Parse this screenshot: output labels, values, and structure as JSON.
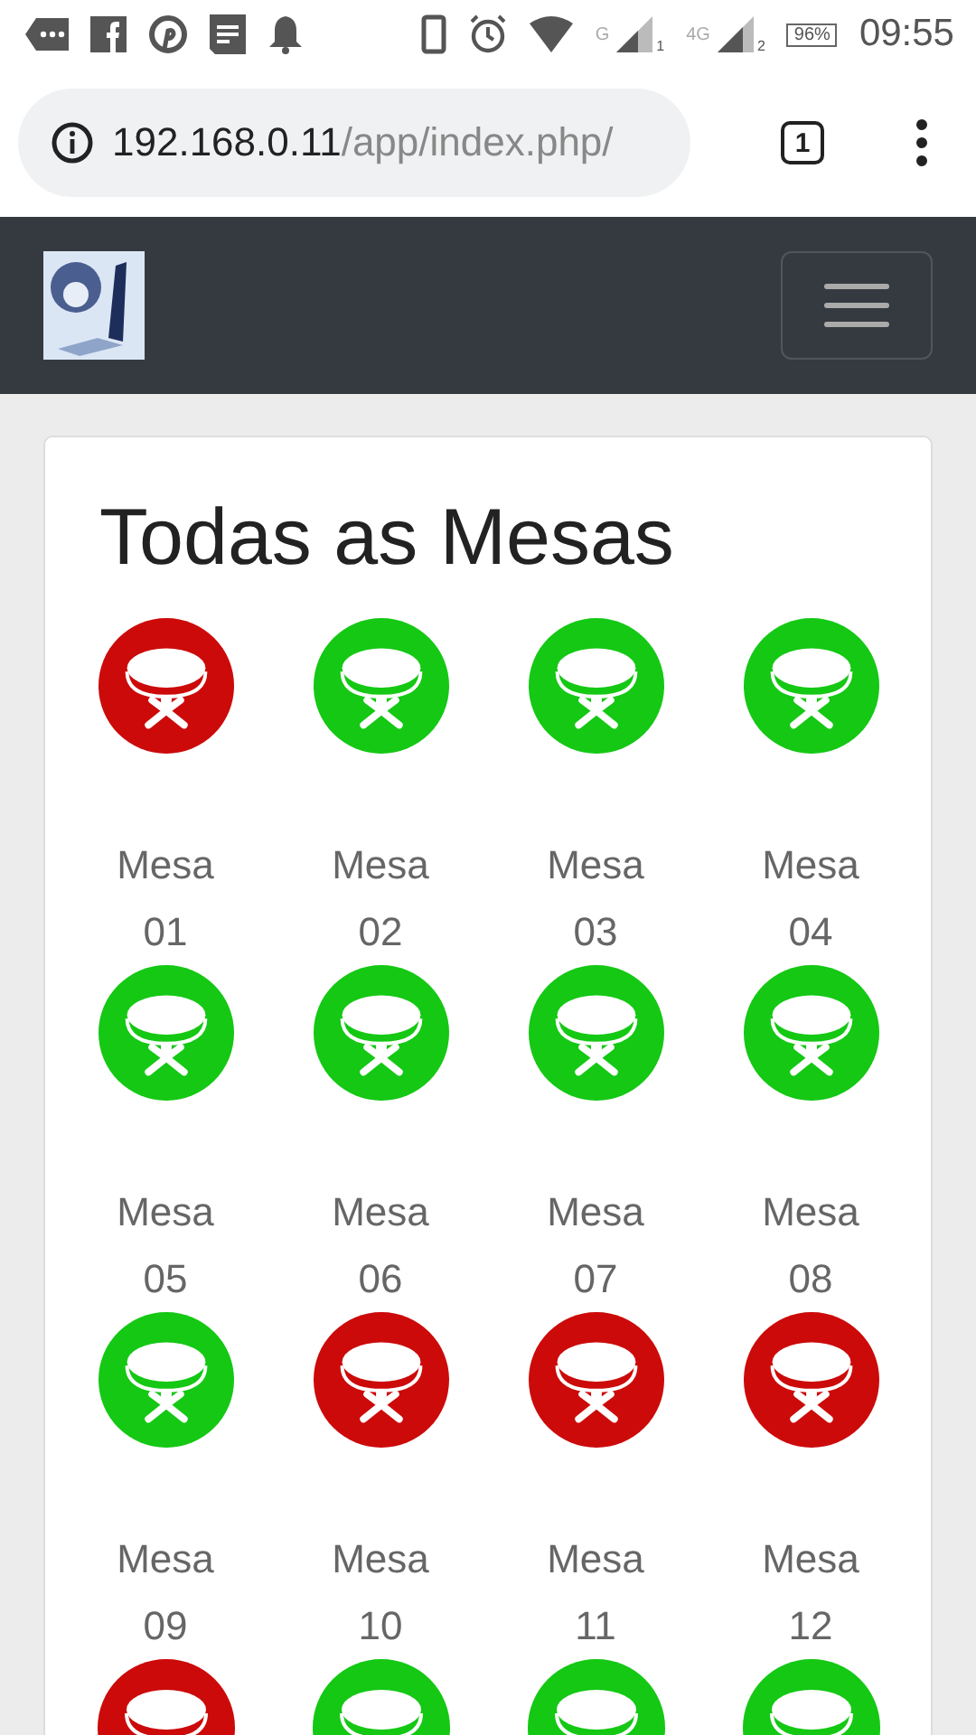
{
  "status_bar": {
    "network_gen_1": "G",
    "sim_1": "1",
    "network_gen_2": "4G",
    "sim_2": "2",
    "battery": "96%",
    "time": "09:55"
  },
  "address_bar": {
    "host": "192.168.0.11",
    "path": "/app/index.php/",
    "tab_count": "1"
  },
  "page": {
    "title": "Todas as Mesas"
  },
  "tables": [
    {
      "label": "Mesa 01",
      "color": "#cc0a0a"
    },
    {
      "label": "Mesa 02",
      "color": "#14c814"
    },
    {
      "label": "Mesa 03",
      "color": "#14c814"
    },
    {
      "label": "Mesa 04",
      "color": "#14c814"
    },
    {
      "label": "Mesa 05",
      "color": "#14c814"
    },
    {
      "label": "Mesa 06",
      "color": "#14c814"
    },
    {
      "label": "Mesa 07",
      "color": "#14c814"
    },
    {
      "label": "Mesa 08",
      "color": "#14c814"
    },
    {
      "label": "Mesa 09",
      "color": "#14c814"
    },
    {
      "label": "Mesa 10",
      "color": "#cc0a0a"
    },
    {
      "label": "Mesa 11",
      "color": "#cc0a0a"
    },
    {
      "label": "Mesa 12",
      "color": "#cc0a0a"
    },
    {
      "color": "#cc0a0a"
    },
    {
      "color": "#14c814"
    },
    {
      "color": "#14c814"
    },
    {
      "color": "#14c814"
    }
  ]
}
